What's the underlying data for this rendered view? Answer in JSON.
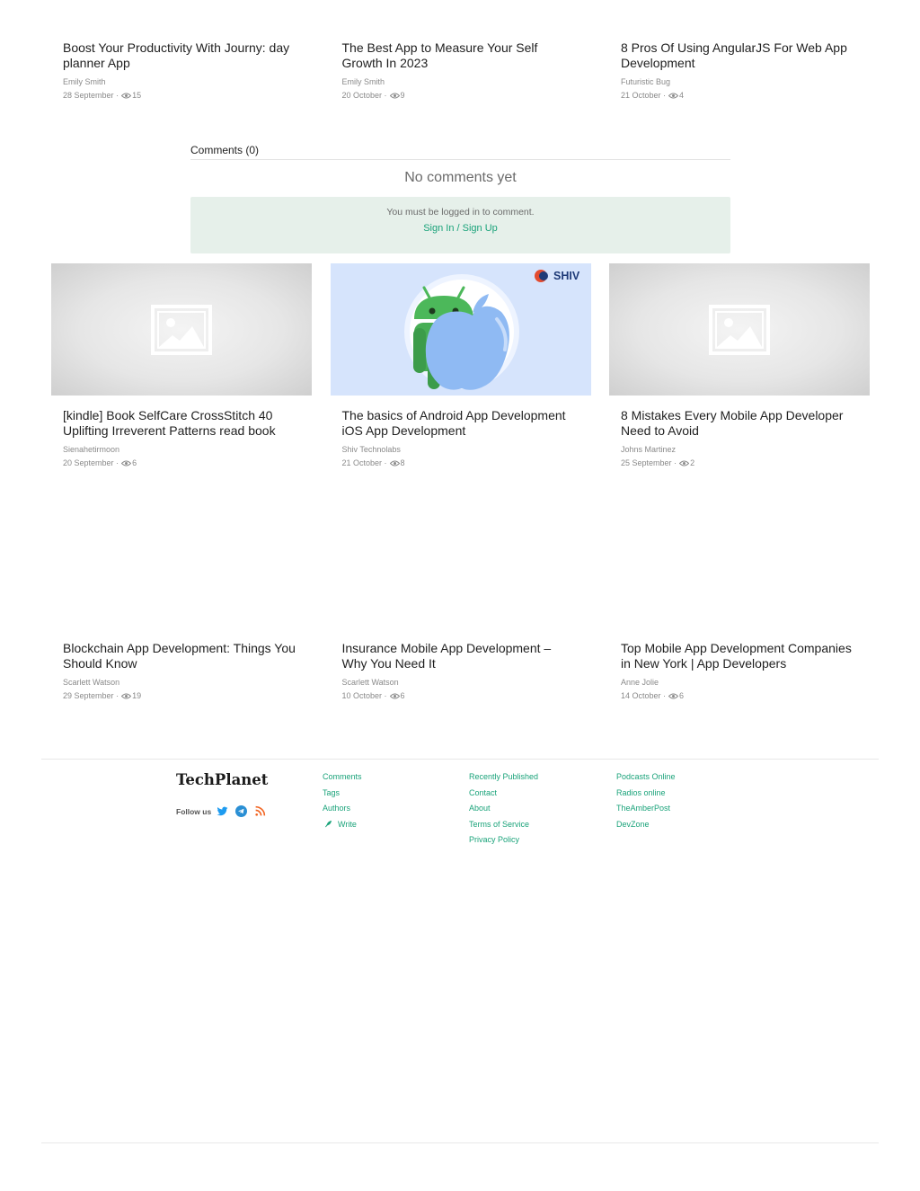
{
  "row1": [
    {
      "title": "Boost Your Productivity With Journy: day planner App",
      "author": "Emily Smith",
      "date": "28 September",
      "views": "15"
    },
    {
      "title": "The Best App to Measure Your Self Growth In 2023",
      "author": "Emily Smith",
      "date": "20 October",
      "views": "9"
    },
    {
      "title": "8 Pros Of Using AngularJS For Web App Development",
      "author": "Futuristic Bug",
      "date": "21 October",
      "views": "4"
    }
  ],
  "comments": {
    "heading": "Comments (0)",
    "empty_text": "No comments yet",
    "login_text": "You must be logged in to comment.",
    "login_link": "Sign In / Sign Up"
  },
  "row2": [
    {
      "title": "[kindle] Book SelfCare CrossStitch 40 Uplifting Irreverent Patterns read book",
      "author": "Sienahetirmoon",
      "date": "20 September",
      "views": "6",
      "image": "placeholder-image-icon"
    },
    {
      "title": "The basics of Android App Development iOS App Development",
      "author": "Shiv Technolabs",
      "date": "21 October",
      "views": "8",
      "image": "android-apple-illustration",
      "brand_text": "SHIV"
    },
    {
      "title": "8 Mistakes Every Mobile App Developer Need to Avoid",
      "author": "Johns Martinez",
      "date": "25 September",
      "views": "2",
      "image": "placeholder-image-icon"
    }
  ],
  "row3": [
    {
      "title": "Blockchain App Development: Things You Should Know",
      "author": "Scarlett Watson",
      "date": "29 September",
      "views": "19"
    },
    {
      "title": "Insurance Mobile App Development – Why You Need It",
      "author": "Scarlett Watson",
      "date": "10 October",
      "views": "6"
    },
    {
      "title": "Top Mobile App Development Companies in New York | App Developers",
      "author": "Anne Jolie",
      "date": "14 October",
      "views": "6"
    }
  ],
  "meta_separator": "·",
  "footer": {
    "brand": "TechPlanet",
    "follow_label": "Follow us",
    "social_icons": [
      "twitter-icon",
      "telegram-icon",
      "rss-icon"
    ],
    "col1": [
      "Comments",
      "Tags",
      "Authors",
      "Write"
    ],
    "col2": [
      "Recently Published",
      "Contact",
      "About",
      "Terms of Service",
      "Privacy Policy"
    ],
    "col3": [
      "Podcasts Online",
      "Radios online",
      "TheAmberPost",
      "DevZone"
    ]
  },
  "colors": {
    "accent": "#1aa37a",
    "login_box": "#e6f0ea",
    "muted_text": "#8a8a8a"
  }
}
